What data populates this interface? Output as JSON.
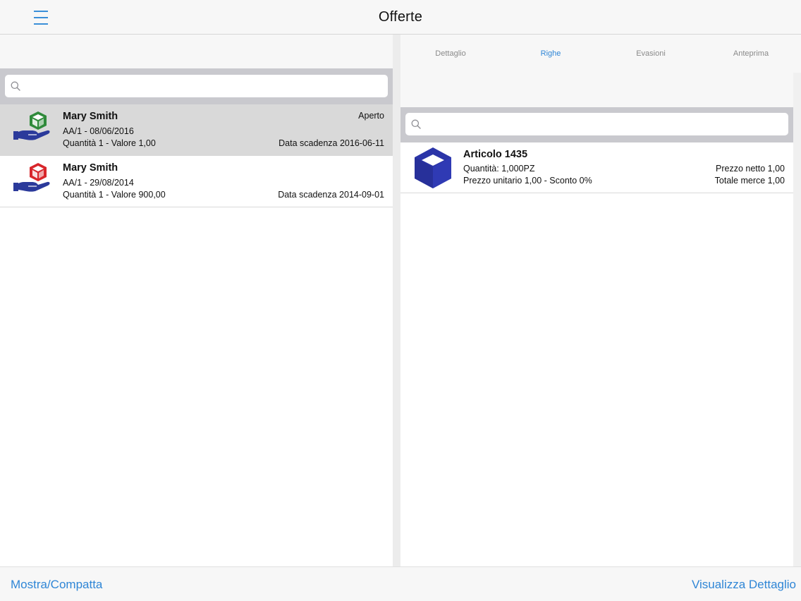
{
  "header": {
    "title": "Offerte",
    "menu_icon": "hamburger-menu-icon"
  },
  "left": {
    "search": {
      "placeholder": ""
    },
    "rows": [
      {
        "name": "Mary Smith",
        "status": "Aperto",
        "doc": "AA/1 - 08/06/2016",
        "summary": "Quantità 1 - Valore 1,00",
        "due": "Data scadenza 2016-06-11",
        "icon": "hand-green-box-icon",
        "selected": true
      },
      {
        "name": "Mary Smith",
        "status": "",
        "doc": "AA/1 - 29/08/2014",
        "summary": "Quantità 1 - Valore 900,00",
        "due": "Data scadenza 2014-09-01",
        "icon": "hand-red-box-icon",
        "selected": false
      }
    ]
  },
  "right": {
    "tabs": [
      {
        "label": "Dettaglio",
        "active": false
      },
      {
        "label": "Righe",
        "active": true
      },
      {
        "label": "Evasioni",
        "active": false
      },
      {
        "label": "Anteprima",
        "active": false
      }
    ],
    "search": {
      "placeholder": ""
    },
    "items": [
      {
        "name": "Articolo 1435",
        "quantity": "Quantità: 1,000PZ",
        "price_line": "Prezzo unitario 1,00 - Sconto 0%",
        "net_price": "Prezzo netto 1,00",
        "total": "Totale merce 1,00",
        "icon": "blue-cube-icon"
      }
    ]
  },
  "toolbar": {
    "left_label": "Mostra/Compatta",
    "right_label": "Visualizza Dettaglio"
  },
  "colors": {
    "accent": "#2f86d6",
    "selected_row": "#d9d9d9",
    "search_bar": "#c9c9ce",
    "cube_blue": "#2b35a8",
    "hand_blue": "#2b3a9b",
    "box_green": "#2f8a3a",
    "box_red": "#d8262b"
  }
}
